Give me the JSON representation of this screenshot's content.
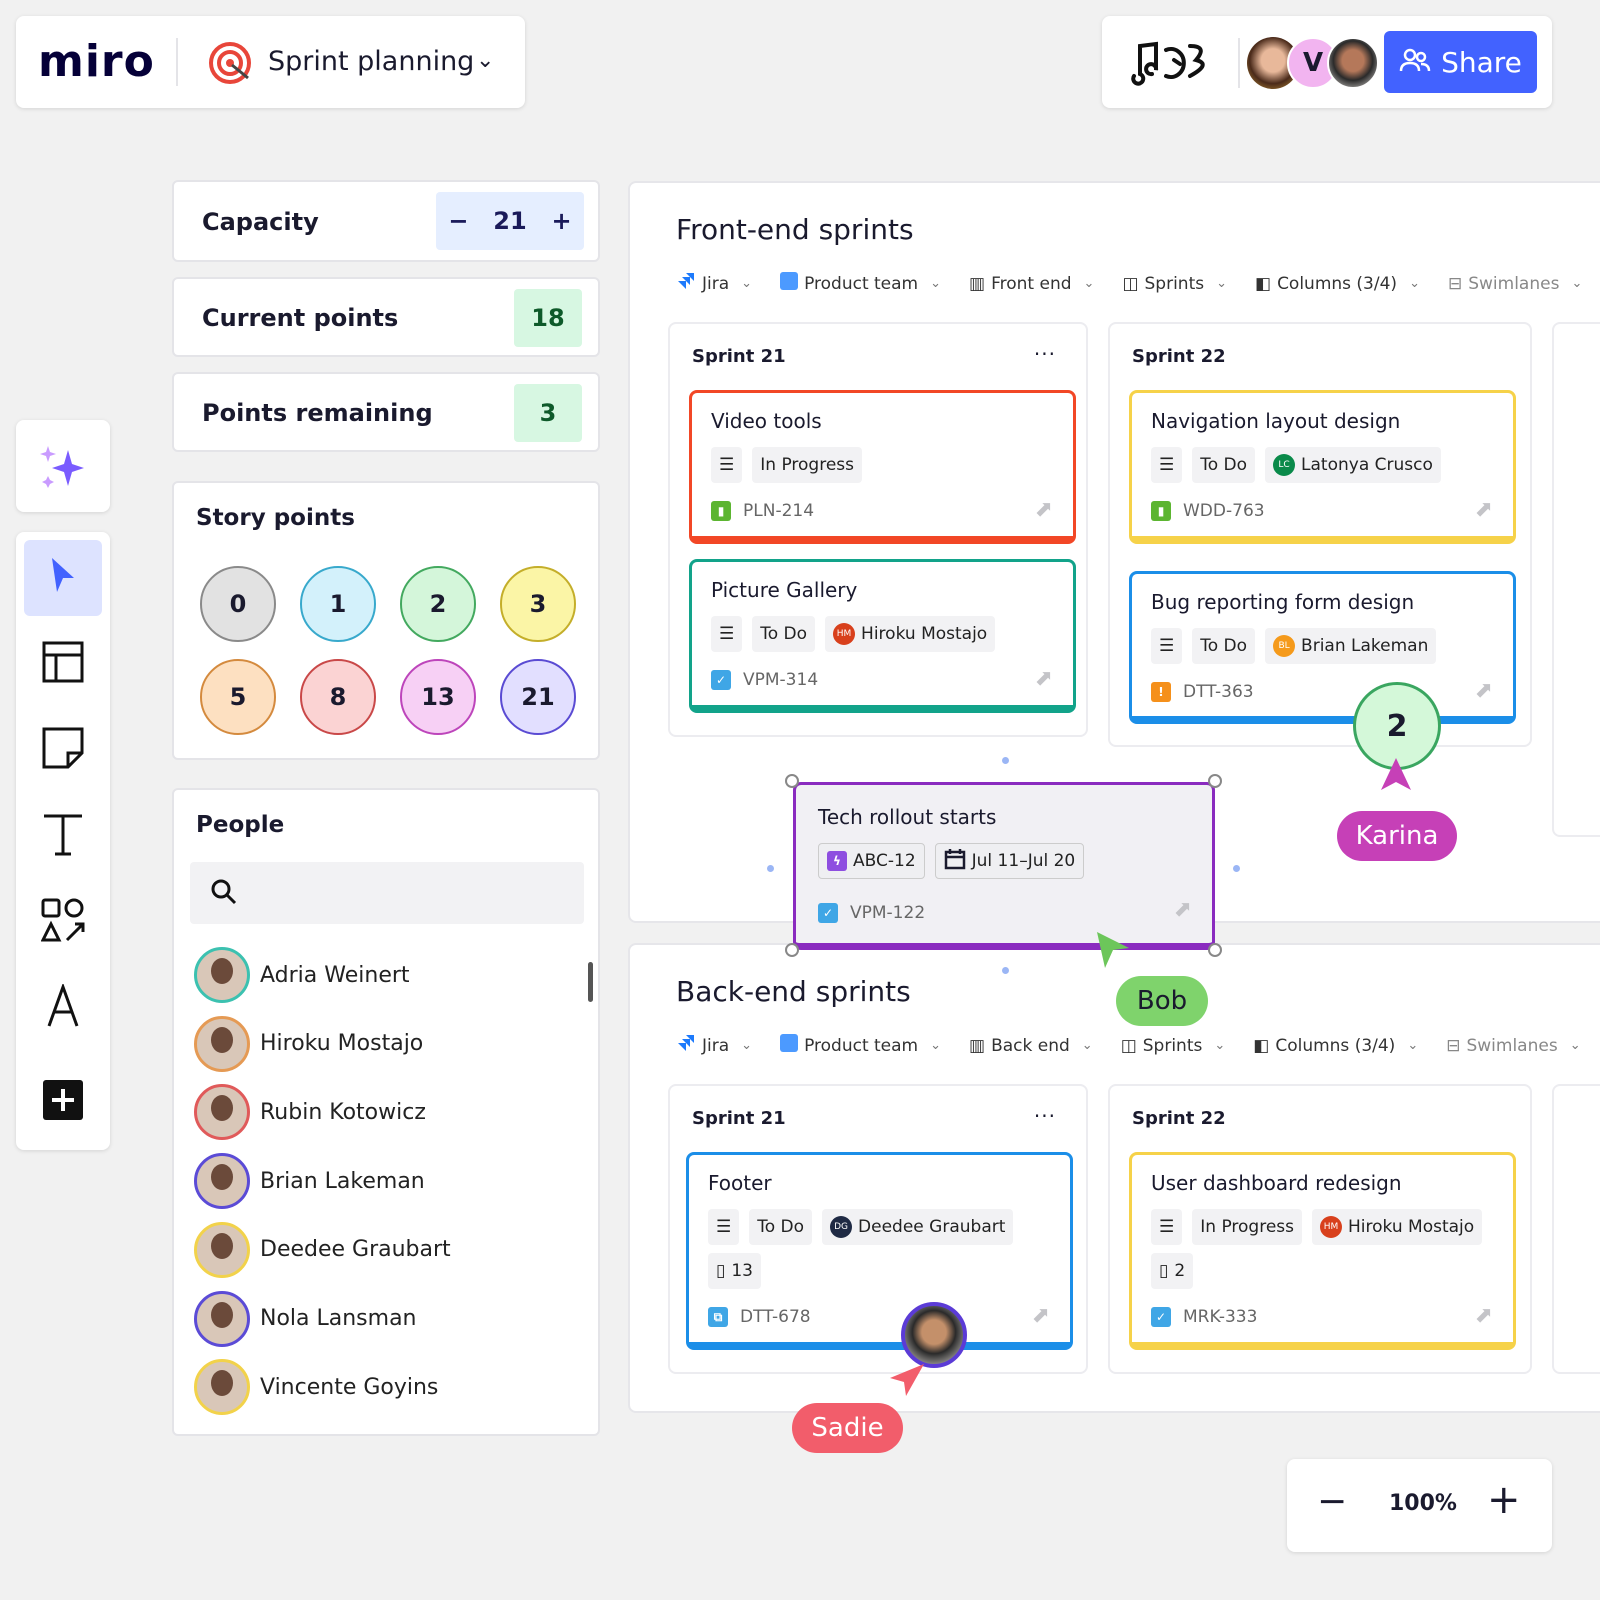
{
  "header": {
    "logo": "miro",
    "board_name": "Sprint planning",
    "share_label": "Share",
    "collaborator_initial": "V"
  },
  "metrics": {
    "capacity": {
      "label": "Capacity",
      "value": "21",
      "minus": "−",
      "plus": "+"
    },
    "current": {
      "label": "Current points",
      "value": "18"
    },
    "remaining": {
      "label": "Points remaining",
      "value": "3"
    }
  },
  "story_points": {
    "title": "Story points",
    "values": [
      {
        "v": "0",
        "bg": "#e2e2e2",
        "bd": "#8a8a8a"
      },
      {
        "v": "1",
        "bg": "#d3f1fb",
        "bd": "#38a9cc"
      },
      {
        "v": "2",
        "bg": "#d4f6da",
        "bd": "#43a95f"
      },
      {
        "v": "3",
        "bg": "#fbf5a6",
        "bd": "#c4ae2a"
      },
      {
        "v": "5",
        "bg": "#fde0c1",
        "bd": "#d48a3e"
      },
      {
        "v": "8",
        "bg": "#fbd3d3",
        "bd": "#c94848"
      },
      {
        "v": "13",
        "bg": "#f7d0f5",
        "bd": "#bd45bb"
      },
      {
        "v": "21",
        "bg": "#e2dfff",
        "bd": "#5a4bd3"
      }
    ]
  },
  "people": {
    "title": "People",
    "search_placeholder": "",
    "list": [
      {
        "name": "Adria Weinert",
        "ring": "#3cc1b0"
      },
      {
        "name": "Hiroku Mostajo",
        "ring": "#e59a54"
      },
      {
        "name": "Rubin Kotowicz",
        "ring": "#e05a5a"
      },
      {
        "name": "Brian Lakeman",
        "ring": "#5b4bd6"
      },
      {
        "name": "Deedee Graubart",
        "ring": "#f2d24a"
      },
      {
        "name": "Nola Lansman",
        "ring": "#5b4bd6"
      },
      {
        "name": "Vincente Goyins",
        "ring": "#f2d24a"
      }
    ]
  },
  "boards": [
    {
      "title": "Front-end sprints",
      "toolbar": [
        "Jira",
        "Product team",
        "Front end",
        "Sprints",
        "Columns (3/4)",
        "Swimlanes"
      ],
      "columns": [
        {
          "title": "Sprint 21",
          "more": "···",
          "cards": [
            {
              "title": "Video tools",
              "color": "#f24726",
              "chips": [
                {
                  "t": "In Progress"
                }
              ],
              "type_color": "#5cb531",
              "type_icon": "bookmark-icon",
              "key": "PLN-214"
            },
            {
              "title": "Picture Gallery",
              "color": "#12a38a",
              "chips": [
                {
                  "t": "To Do"
                },
                {
                  "t": "Hiroku Mostajo",
                  "ini": "HM",
                  "ic": "#d8401c"
                }
              ],
              "type_color": "#3fa6e6",
              "type_icon": "checkbox-icon",
              "key": "VPM-314"
            }
          ]
        },
        {
          "title": "Sprint 22",
          "cards": [
            {
              "title": "Navigation layout design",
              "color": "#f6d249",
              "chips": [
                {
                  "t": "To Do"
                },
                {
                  "t": "Latonya Crusco",
                  "ini": "LC",
                  "ic": "#0a8a4a"
                }
              ],
              "type_color": "#5cb531",
              "type_icon": "bookmark-icon",
              "key": "WDD-763"
            },
            {
              "title": "Bug reporting form design",
              "color": "#1b8ee8",
              "chips": [
                {
                  "t": "To Do"
                },
                {
                  "t": "Brian Lakeman",
                  "ini": "BL",
                  "ic": "#f59a1b"
                }
              ],
              "type_color": "#f5901b",
              "type_icon": "alert-icon",
              "key": "DTT-363"
            }
          ]
        }
      ]
    },
    {
      "title": "Back-end sprints",
      "toolbar": [
        "Jira",
        "Product team",
        "Back end",
        "Sprints",
        "Columns (3/4)",
        "Swimlanes"
      ],
      "columns": [
        {
          "title": "Sprint 21",
          "more": "···",
          "cards": [
            {
              "title": "Footer",
              "color": "#1b8ee8",
              "chips": [
                {
                  "t": "To Do"
                },
                {
                  "t": "Deedee Graubart",
                  "ini": "DG",
                  "ic": "#1f2a44"
                }
              ],
              "points": "13",
              "type_color": "#3fa6e6",
              "type_icon": "subtask-icon",
              "key": "DTT-678"
            }
          ]
        },
        {
          "title": "Sprint 22",
          "cards": [
            {
              "title": "User dashboard redesign",
              "color": "#f6d249",
              "chips": [
                {
                  "t": "In Progress"
                },
                {
                  "t": "Hiroku Mostajo",
                  "ini": "HM",
                  "ic": "#d8401c"
                }
              ],
              "points": "2",
              "type_color": "#3fa6e6",
              "type_icon": "checkbox-icon",
              "key": "MRK-333"
            }
          ]
        }
      ]
    }
  ],
  "floating_card": {
    "title": "Tech rollout starts",
    "epic": "ABC-12",
    "dates": "Jul 11–Jul 20",
    "key": "VPM-122"
  },
  "vote_bubble": "2",
  "cursors": {
    "karina": {
      "name": "Karina",
      "color": "#c640b7"
    },
    "bob": {
      "name": "Bob",
      "color": "#7fd36c"
    },
    "sadie": {
      "name": "Sadie",
      "color": "#f25d6b"
    }
  },
  "zoom": {
    "level": "100%",
    "minus": "−",
    "plus": "+"
  }
}
